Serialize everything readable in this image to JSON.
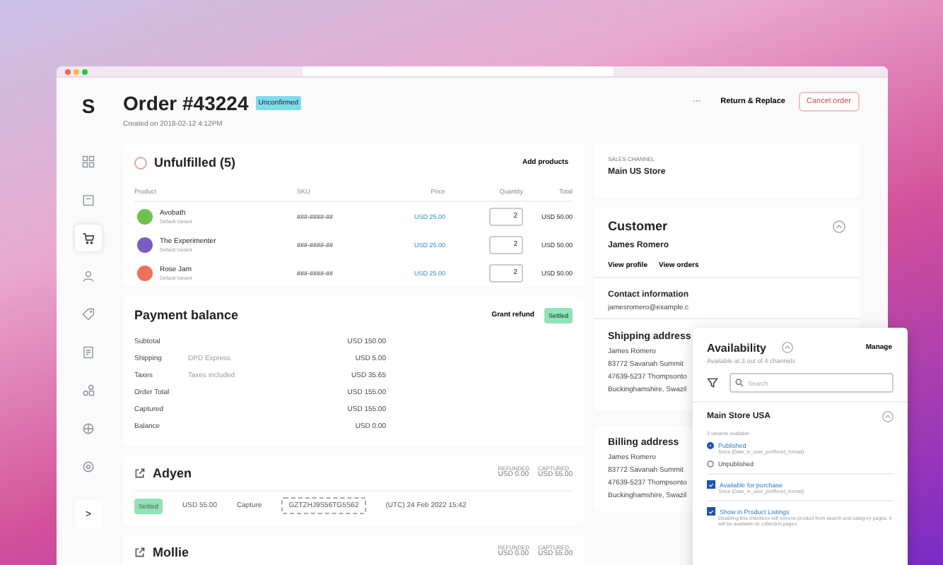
{
  "sidebar": {
    "logo": "S",
    "items": [
      {
        "kind": "grid",
        "selected": false
      },
      {
        "kind": "box",
        "selected": false
      },
      {
        "kind": "cart",
        "selected": true
      },
      {
        "kind": "user",
        "selected": false
      },
      {
        "kind": "tag",
        "selected": false
      },
      {
        "kind": "receipt",
        "selected": false
      },
      {
        "kind": "shapes",
        "selected": false
      },
      {
        "kind": "globe",
        "selected": false
      },
      {
        "kind": "settings",
        "selected": false
      }
    ],
    "expand": ">"
  },
  "header": {
    "title": "Order #43224",
    "status": "Unconfirmed",
    "created": "Created on 2018-02-12 4:12PM",
    "more": "···",
    "actions": [
      {
        "label": "Return & Replace",
        "kind": "plain"
      },
      {
        "label": "Cancel order",
        "kind": "danger"
      }
    ]
  },
  "unfulfilled": {
    "title": "Unfulfilled (5)",
    "add": "Add products",
    "columns": [
      "Product",
      "SKU",
      "Price",
      "Quantity",
      "Total"
    ],
    "rows": [
      {
        "name": "Avobath",
        "variant": "Default Variant",
        "sku": "###-####-##",
        "price": "USD 25.00",
        "quantity": "2",
        "total": "USD 50.00",
        "color": "#6cc24a"
      },
      {
        "name": "The Experimenter",
        "variant": "Default Variant",
        "sku": "###-####-##",
        "price": "USD 25.00",
        "quantity": "2",
        "total": "USD 50.00",
        "color": "#7b5cc4"
      },
      {
        "name": "Rose Jam",
        "variant": "Default Variant",
        "sku": "###-####-##",
        "price": "USD 25.00",
        "quantity": "2",
        "total": "USD 50.00",
        "color": "#f0705a"
      }
    ]
  },
  "payment": {
    "title": "Payment balance",
    "refund": "Grant refund",
    "status": "Settled",
    "rows": [
      {
        "label": "Subtotal",
        "value": "USD 150.00"
      },
      {
        "label": "Shipping",
        "note": "DPD Express",
        "value": "USD 5.00"
      },
      {
        "label": "Taxes",
        "note": "Taxes included",
        "value": "USD 35.65"
      },
      {
        "label": "Order Total",
        "value": "USD 155.00"
      },
      {
        "label": "Captured",
        "value": "USD 155.00"
      },
      {
        "label": "Balance",
        "value": "USD 0.00"
      }
    ]
  },
  "transactions": [
    {
      "name": "Adyen",
      "refunded_label": "REFUNDED",
      "refunded": "USD 0.00",
      "captured_label": "CAPTURED",
      "captured": "USD 55.00",
      "events": [
        {
          "status": "Settled",
          "amount": "USD 55.00",
          "type": "Capture",
          "psp": "GZTZHJ9S56TG5S62",
          "date": "(UTC) 24 Feb 2022 15:42"
        }
      ]
    },
    {
      "name": "Mollie",
      "refunded_label": "REFUNDED",
      "refunded": "USD 0.00",
      "captured_label": "CAPTURED",
      "captured": "USD 55.00"
    }
  ],
  "sales_channel": {
    "label": "SALES CHANNEL",
    "value": "Main US Store"
  },
  "customer": {
    "title": "Customer",
    "name": "James Romero",
    "buttons": [
      "View profile",
      "View orders"
    ],
    "contact_title": "Contact information",
    "email": "jamesromero@example.c",
    "shipping_title": "Shipping address",
    "shipping": [
      "James Romero",
      "83772 Savanah Summit",
      "47639-5237 Thompsonto",
      "Buckinghamshire, Swazil"
    ]
  },
  "billing": {
    "title": "Billing address",
    "lines": [
      "James Romero",
      "83772 Savanah Summit",
      "47639-5237 Thompsonto",
      "Buckinghamshire, Swazil"
    ]
  },
  "availability": {
    "title": "Availability",
    "manage": "Manage",
    "subtitle": "Available at 3 out of 4 channels",
    "search_placeholder": "Search",
    "channel": "Main Store USA",
    "variants": "3 variants available",
    "publish_options": [
      {
        "label": "Published",
        "note": "Since {Date_in_user_preffered_format}",
        "selected": true
      },
      {
        "label": "Unpublished",
        "selected": false
      }
    ],
    "checks": [
      {
        "label": "Available for purchase",
        "note": "Since {Date_in_user_preffered_format}",
        "checked": true
      },
      {
        "label": "Show in Product Listings",
        "note": "Disabling this checkbox will remove product from search and category pages. It will be available on collection pages.",
        "checked": true
      }
    ]
  }
}
